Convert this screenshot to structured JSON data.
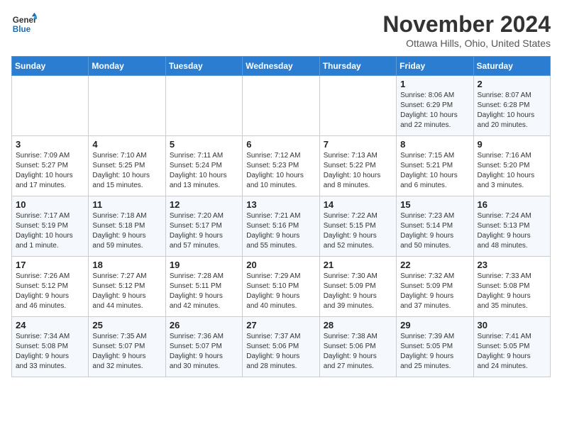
{
  "logo": {
    "line1": "General",
    "line2": "Blue"
  },
  "title": "November 2024",
  "subtitle": "Ottawa Hills, Ohio, United States",
  "days_of_week": [
    "Sunday",
    "Monday",
    "Tuesday",
    "Wednesday",
    "Thursday",
    "Friday",
    "Saturday"
  ],
  "weeks": [
    [
      {
        "num": "",
        "detail": ""
      },
      {
        "num": "",
        "detail": ""
      },
      {
        "num": "",
        "detail": ""
      },
      {
        "num": "",
        "detail": ""
      },
      {
        "num": "",
        "detail": ""
      },
      {
        "num": "1",
        "detail": "Sunrise: 8:06 AM\nSunset: 6:29 PM\nDaylight: 10 hours\nand 22 minutes."
      },
      {
        "num": "2",
        "detail": "Sunrise: 8:07 AM\nSunset: 6:28 PM\nDaylight: 10 hours\nand 20 minutes."
      }
    ],
    [
      {
        "num": "3",
        "detail": "Sunrise: 7:09 AM\nSunset: 5:27 PM\nDaylight: 10 hours\nand 17 minutes."
      },
      {
        "num": "4",
        "detail": "Sunrise: 7:10 AM\nSunset: 5:25 PM\nDaylight: 10 hours\nand 15 minutes."
      },
      {
        "num": "5",
        "detail": "Sunrise: 7:11 AM\nSunset: 5:24 PM\nDaylight: 10 hours\nand 13 minutes."
      },
      {
        "num": "6",
        "detail": "Sunrise: 7:12 AM\nSunset: 5:23 PM\nDaylight: 10 hours\nand 10 minutes."
      },
      {
        "num": "7",
        "detail": "Sunrise: 7:13 AM\nSunset: 5:22 PM\nDaylight: 10 hours\nand 8 minutes."
      },
      {
        "num": "8",
        "detail": "Sunrise: 7:15 AM\nSunset: 5:21 PM\nDaylight: 10 hours\nand 6 minutes."
      },
      {
        "num": "9",
        "detail": "Sunrise: 7:16 AM\nSunset: 5:20 PM\nDaylight: 10 hours\nand 3 minutes."
      }
    ],
    [
      {
        "num": "10",
        "detail": "Sunrise: 7:17 AM\nSunset: 5:19 PM\nDaylight: 10 hours\nand 1 minute."
      },
      {
        "num": "11",
        "detail": "Sunrise: 7:18 AM\nSunset: 5:18 PM\nDaylight: 9 hours\nand 59 minutes."
      },
      {
        "num": "12",
        "detail": "Sunrise: 7:20 AM\nSunset: 5:17 PM\nDaylight: 9 hours\nand 57 minutes."
      },
      {
        "num": "13",
        "detail": "Sunrise: 7:21 AM\nSunset: 5:16 PM\nDaylight: 9 hours\nand 55 minutes."
      },
      {
        "num": "14",
        "detail": "Sunrise: 7:22 AM\nSunset: 5:15 PM\nDaylight: 9 hours\nand 52 minutes."
      },
      {
        "num": "15",
        "detail": "Sunrise: 7:23 AM\nSunset: 5:14 PM\nDaylight: 9 hours\nand 50 minutes."
      },
      {
        "num": "16",
        "detail": "Sunrise: 7:24 AM\nSunset: 5:13 PM\nDaylight: 9 hours\nand 48 minutes."
      }
    ],
    [
      {
        "num": "17",
        "detail": "Sunrise: 7:26 AM\nSunset: 5:12 PM\nDaylight: 9 hours\nand 46 minutes."
      },
      {
        "num": "18",
        "detail": "Sunrise: 7:27 AM\nSunset: 5:12 PM\nDaylight: 9 hours\nand 44 minutes."
      },
      {
        "num": "19",
        "detail": "Sunrise: 7:28 AM\nSunset: 5:11 PM\nDaylight: 9 hours\nand 42 minutes."
      },
      {
        "num": "20",
        "detail": "Sunrise: 7:29 AM\nSunset: 5:10 PM\nDaylight: 9 hours\nand 40 minutes."
      },
      {
        "num": "21",
        "detail": "Sunrise: 7:30 AM\nSunset: 5:09 PM\nDaylight: 9 hours\nand 39 minutes."
      },
      {
        "num": "22",
        "detail": "Sunrise: 7:32 AM\nSunset: 5:09 PM\nDaylight: 9 hours\nand 37 minutes."
      },
      {
        "num": "23",
        "detail": "Sunrise: 7:33 AM\nSunset: 5:08 PM\nDaylight: 9 hours\nand 35 minutes."
      }
    ],
    [
      {
        "num": "24",
        "detail": "Sunrise: 7:34 AM\nSunset: 5:08 PM\nDaylight: 9 hours\nand 33 minutes."
      },
      {
        "num": "25",
        "detail": "Sunrise: 7:35 AM\nSunset: 5:07 PM\nDaylight: 9 hours\nand 32 minutes."
      },
      {
        "num": "26",
        "detail": "Sunrise: 7:36 AM\nSunset: 5:07 PM\nDaylight: 9 hours\nand 30 minutes."
      },
      {
        "num": "27",
        "detail": "Sunrise: 7:37 AM\nSunset: 5:06 PM\nDaylight: 9 hours\nand 28 minutes."
      },
      {
        "num": "28",
        "detail": "Sunrise: 7:38 AM\nSunset: 5:06 PM\nDaylight: 9 hours\nand 27 minutes."
      },
      {
        "num": "29",
        "detail": "Sunrise: 7:39 AM\nSunset: 5:05 PM\nDaylight: 9 hours\nand 25 minutes."
      },
      {
        "num": "30",
        "detail": "Sunrise: 7:41 AM\nSunset: 5:05 PM\nDaylight: 9 hours\nand 24 minutes."
      }
    ]
  ]
}
